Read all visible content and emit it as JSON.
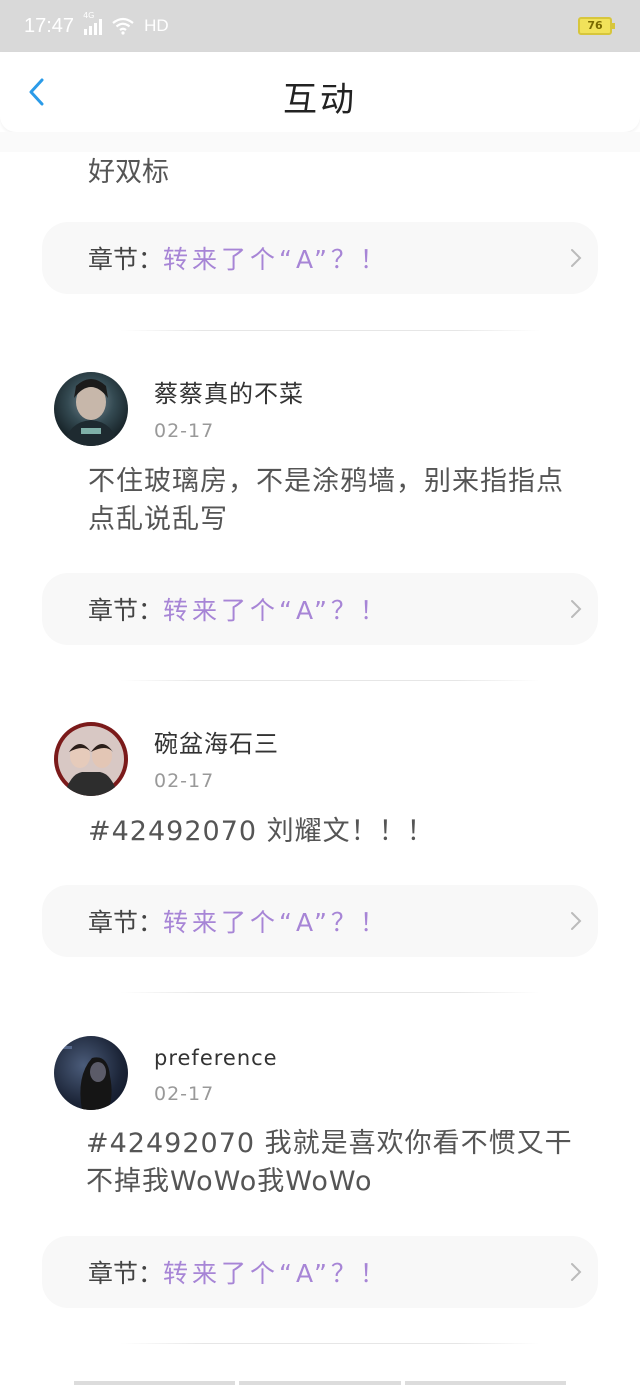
{
  "status": {
    "time": "17:47",
    "network": "4G",
    "hd": "HD",
    "battery": "76"
  },
  "header": {
    "title": "互动"
  },
  "first_comment_tail": "好双标",
  "chapter": {
    "prefix": "章节：",
    "title": "转来了个“A”？！"
  },
  "comments": [
    {
      "username": "蔡蔡真的不菜",
      "date": "02-17",
      "content": "不住玻璃房，不是涂鸦墙，别来指指点点乱说乱写"
    },
    {
      "username": "碗盆海石三",
      "date": "02-17",
      "content": "#42492070 刘耀文！！！"
    },
    {
      "username": "preference",
      "date": "02-17",
      "content": "#42492070 我就是喜欢你看不惯又干不掉我WoWo我WoWo"
    }
  ],
  "colors": {
    "accent": "#2b9be8",
    "chapter": "#a785d6",
    "status_bar": "#d9d9d9"
  }
}
